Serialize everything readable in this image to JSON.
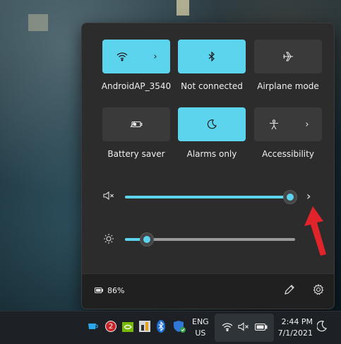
{
  "tiles": {
    "wifi": {
      "label": "AndroidAP_3540",
      "icon": "wifi-icon",
      "active": true
    },
    "bluetooth": {
      "label": "Not connected",
      "icon": "bluetooth-icon",
      "active": true
    },
    "airplane": {
      "label": "Airplane mode",
      "icon": "airplane-icon",
      "active": false
    },
    "battery_saver": {
      "label": "Battery saver",
      "icon": "battery-saver-icon",
      "active": false
    },
    "focus": {
      "label": "Alarms only",
      "icon": "moon-icon",
      "active": true
    },
    "accessibility": {
      "label": "Accessibility",
      "icon": "accessibility-icon",
      "active": false
    }
  },
  "volume": {
    "icon": "speaker-muted-icon",
    "level": 0.97
  },
  "brightness": {
    "icon": "sun-icon",
    "level": 0.13
  },
  "footer": {
    "battery_text": "86%",
    "battery_icon": "battery-icon",
    "edit_icon": "pencil-icon",
    "settings_icon": "gear-icon"
  },
  "taskbar": {
    "language": [
      "ENG",
      "US"
    ],
    "time": "2:44 PM",
    "date": "7/1/2021",
    "notification_badge": "2",
    "icons": [
      "tea-icon",
      "badge-app-icon",
      "nvidia-icon",
      "app-tile-icon",
      "bluetooth-tray-icon",
      "defender-icon",
      "wifi-tray-icon",
      "speaker-muted-tray-icon",
      "battery-tray-icon",
      "moon-tray-icon"
    ]
  },
  "colors": {
    "accent": "#5dd4ee",
    "panel": "#2c2c2c",
    "arrow": "#e0242a"
  }
}
